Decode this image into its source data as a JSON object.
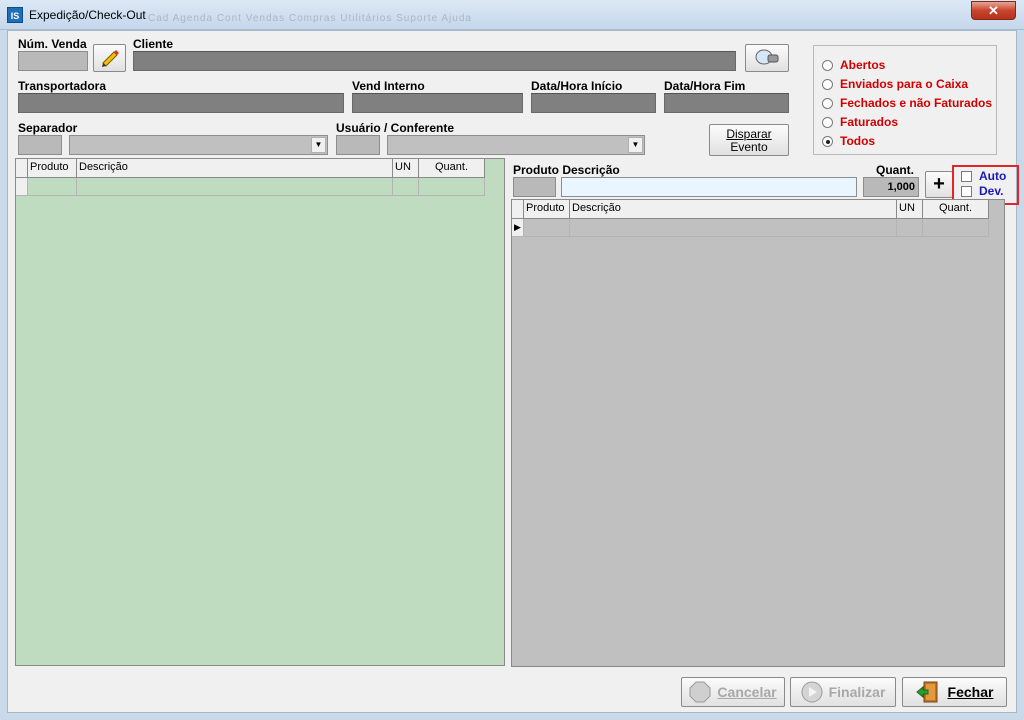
{
  "window": {
    "title": "Expedição/Check-Out",
    "close_label": "✕",
    "app_icon": "IS",
    "ghost_menu": "Cad  Agenda  Cont  Vendas  Compras  Utilitários  Suporte  Ajuda"
  },
  "fields": {
    "num_venda": "Núm. Venda",
    "cliente": "Cliente",
    "transportadora": "Transportadora",
    "vend_interno": "Vend Interno",
    "data_inicio": "Data/Hora Início",
    "data_fim": "Data/Hora Fim",
    "separador": "Separador",
    "usuario_conferente": "Usuário / Conferente"
  },
  "buttons": {
    "disparar_evento": [
      "Disparar",
      "Evento"
    ],
    "plus": "+",
    "cancelar": "Cancelar",
    "finalizar": "Finalizar",
    "fechar": "Fechar"
  },
  "filters": {
    "options": [
      "Abertos",
      "Enviados para o Caixa",
      "Fechados e não Faturados",
      "Faturados",
      "Todos"
    ],
    "selected": "Todos"
  },
  "left_grid": {
    "columns": [
      "Produto",
      "Descrição",
      "UN",
      "Quant."
    ]
  },
  "right_panel": {
    "label_produto_descricao": "Produto Descrição",
    "label_quant": "Quant.",
    "quant_value": "1,000",
    "check_auto": "Auto",
    "check_dev": "Dev."
  },
  "right_grid": {
    "columns": [
      "Produto",
      "Descrição",
      "UN",
      "Quant."
    ]
  }
}
